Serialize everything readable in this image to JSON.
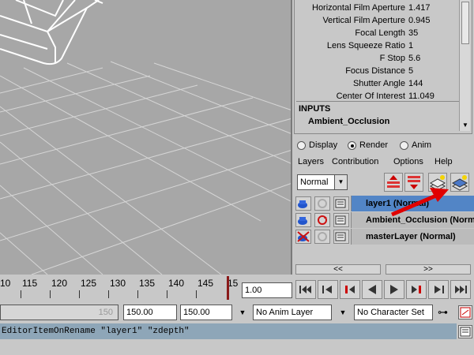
{
  "camera_attrs": [
    {
      "label": "Horizontal Film Aperture",
      "value": "1.417"
    },
    {
      "label": "Vertical Film Aperture",
      "value": "0.945"
    },
    {
      "label": "Focal Length",
      "value": "35"
    },
    {
      "label": "Lens Squeeze Ratio",
      "value": "1"
    },
    {
      "label": "F Stop",
      "value": "5.6"
    },
    {
      "label": "Focus Distance",
      "value": "5"
    },
    {
      "label": "Shutter Angle",
      "value": "144"
    },
    {
      "label": "Center Of Interest",
      "value": "11.049"
    }
  ],
  "inputs": {
    "header": "INPUTS",
    "node": "Ambient_Occlusion"
  },
  "layer_editor": {
    "modes": [
      {
        "label": "Display",
        "selected": false
      },
      {
        "label": "Render",
        "selected": true
      },
      {
        "label": "Anim",
        "selected": false
      }
    ],
    "menu": [
      "Layers",
      "Contribution",
      "Options",
      "Help"
    ],
    "blend_mode": "Normal",
    "layers": [
      {
        "name": "layer1 (Normal)",
        "selected": true
      },
      {
        "name": "Ambient_Occlusion (Normal)",
        "selected": false
      },
      {
        "name": "masterLayer (Normal)",
        "selected": false
      }
    ],
    "nav_prev": "<<",
    "nav_next": ">>",
    "accent_color": "#5285c6",
    "annotation_arrow_color": "#e00000"
  },
  "timeline": {
    "ticks": [
      "10",
      "115",
      "120",
      "125",
      "130",
      "135",
      "140",
      "145",
      "15"
    ],
    "current_frame": "1.00"
  },
  "range": {
    "start_placeholder": "150",
    "range_end": "150.00",
    "anim_end": "150.00",
    "anim_layer": "No Anim Layer",
    "character_set": "No Character Set"
  },
  "command_line": {
    "text": "EditorItemOnRename \"layer1\" \"zdepth\""
  },
  "icons": {
    "playback": [
      "go-to-start-icon",
      "step-back-key-icon",
      "step-back-frame-icon",
      "play-backward-icon",
      "play-forward-icon",
      "step-forward-frame-icon",
      "step-forward-key-icon",
      "go-to-end-icon"
    ]
  }
}
